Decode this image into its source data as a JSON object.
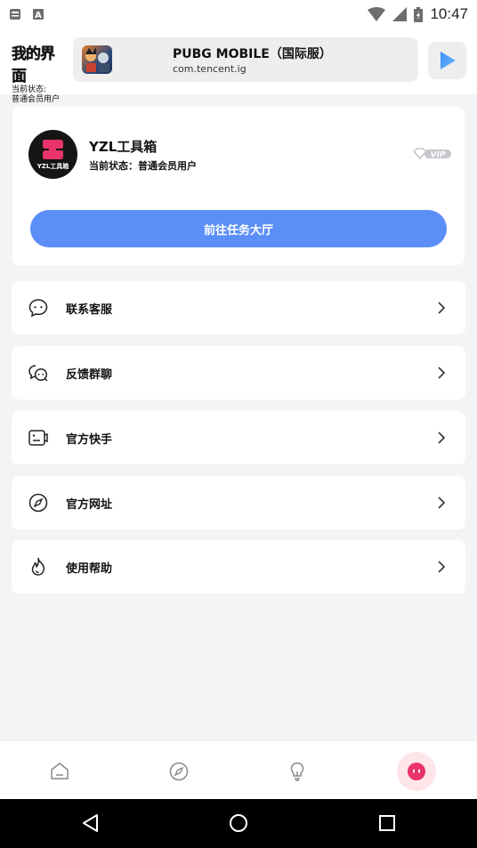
{
  "status_bar": {
    "time": "10:47",
    "left_icons": [
      "notification-icon",
      "a-letter-icon"
    ],
    "right_icons": [
      "wifi-icon",
      "cell-signal-icon",
      "battery-icon"
    ]
  },
  "header": {
    "title": "我的界面",
    "status_label": "当前状态:",
    "status_value": "普通会员用户",
    "app": {
      "name": "PUBG MOBILE（国际服）",
      "package": "com.tencent.ig",
      "icon": "pubg-app-icon"
    },
    "play_icon": "play-icon"
  },
  "profile": {
    "avatar_text": "YZL工具箱",
    "name": "YZL工具箱",
    "status": "当前状态：普通会员用户",
    "vip_label": "VIP",
    "task_button": "前往任务大厅"
  },
  "menu": [
    {
      "label": "联系客服",
      "icon": "chat-bubble-icon"
    },
    {
      "label": "反馈群聊",
      "icon": "group-chat-icon"
    },
    {
      "label": "官方快手",
      "icon": "video-card-icon"
    },
    {
      "label": "官方网址",
      "icon": "compass-icon"
    },
    {
      "label": "使用帮助",
      "icon": "flame-icon"
    }
  ],
  "bottom_nav": [
    {
      "name": "home",
      "icon": "home-icon",
      "active": false
    },
    {
      "name": "discover",
      "icon": "compass-icon",
      "active": false
    },
    {
      "name": "ideas",
      "icon": "lightbulb-icon",
      "active": false
    },
    {
      "name": "mine",
      "icon": "smile-face-icon",
      "active": true
    }
  ],
  "colors": {
    "accent": "#5b8ef7",
    "active_nav": "#e8336b",
    "active_nav_bg": "#fde5ea",
    "page_bg": "#f4f4f6"
  }
}
